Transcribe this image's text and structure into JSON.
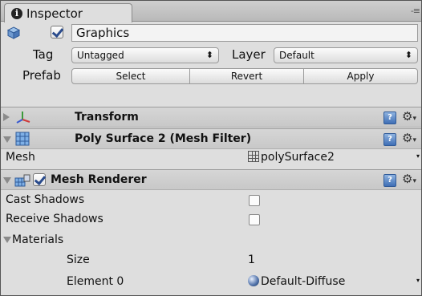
{
  "tab": {
    "title": "Inspector",
    "menu_glyph": "-≡"
  },
  "gameobject": {
    "active": true,
    "name": "Graphics",
    "tag_label": "Tag",
    "tag_value": "Untagged",
    "layer_label": "Layer",
    "layer_value": "Default",
    "prefab_label": "Prefab",
    "prefab_buttons": [
      "Select",
      "Revert",
      "Apply"
    ]
  },
  "components": {
    "transform": {
      "title": "Transform"
    },
    "mesh_filter": {
      "title": "Poly Surface 2 (Mesh Filter)",
      "mesh_label": "Mesh",
      "mesh_value": "polySurface2"
    },
    "mesh_renderer": {
      "title": "Mesh Renderer",
      "enabled": true,
      "cast_shadows_label": "Cast Shadows",
      "cast_shadows": false,
      "receive_shadows_label": "Receive Shadows",
      "receive_shadows": false,
      "materials_label": "Materials",
      "size_label": "Size",
      "size_value": "1",
      "element0_label": "Element 0",
      "element0_value": "Default-Diffuse"
    }
  },
  "icons": {
    "info": "info-icon",
    "help": "help-icon",
    "gear": "gear-icon"
  },
  "colors": {
    "panel_bg": "#dedede",
    "header_bg": "#c8c8c8",
    "help_blue": "#3f6fb5"
  }
}
